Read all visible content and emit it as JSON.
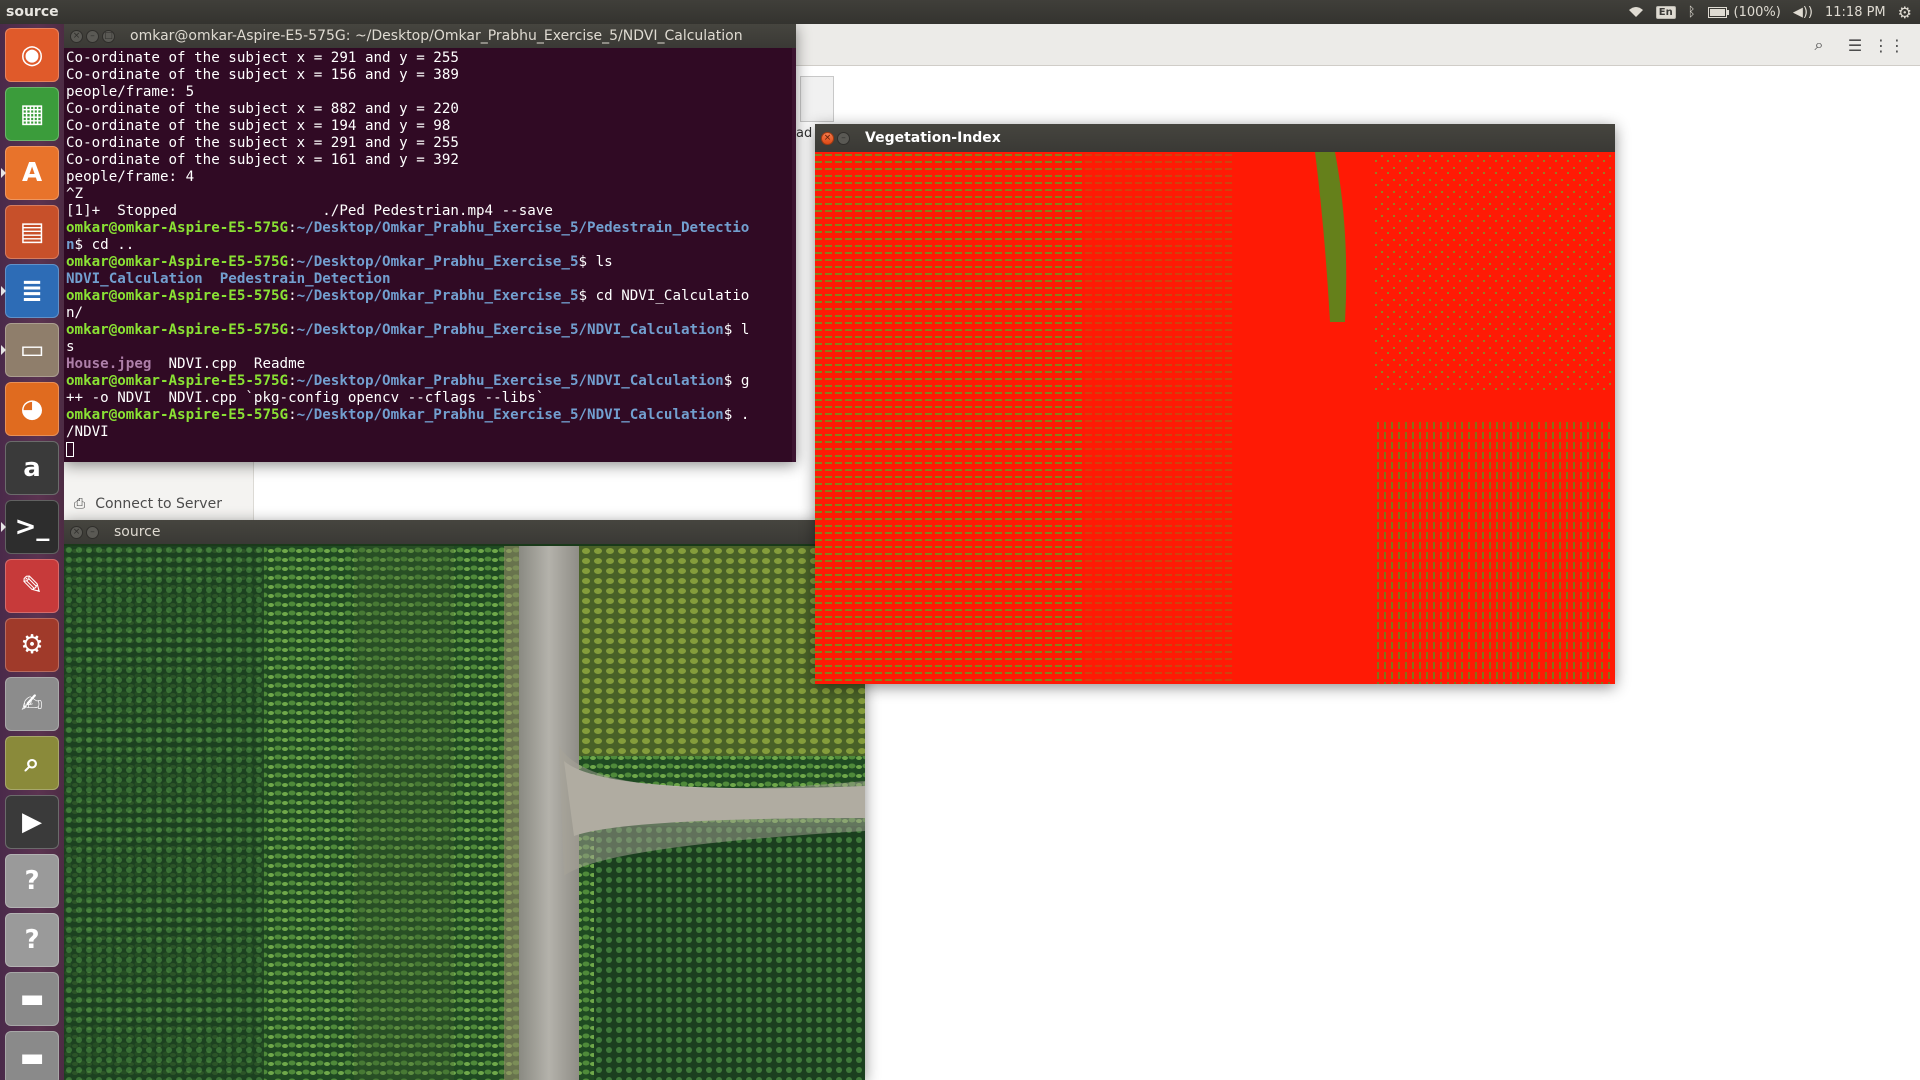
{
  "top_panel": {
    "app_title": "source",
    "keyboard": "En",
    "battery": "(100%)",
    "time": "11:18 PM"
  },
  "launcher": {
    "items": [
      {
        "name": "dash-home-icon",
        "glyph": "◉",
        "bg": "#e05a2a"
      },
      {
        "name": "libreoffice-calc-icon",
        "glyph": "▦",
        "bg": "#3b9c3b"
      },
      {
        "name": "software-center-icon",
        "glyph": "A",
        "bg": "#e8732b"
      },
      {
        "name": "libreoffice-impress-icon",
        "glyph": "▤",
        "bg": "#c7502a"
      },
      {
        "name": "libreoffice-writer-icon",
        "glyph": "≣",
        "bg": "#2d6cb6"
      },
      {
        "name": "files-icon",
        "glyph": "▭",
        "bg": "#8f7e6b"
      },
      {
        "name": "firefox-icon",
        "glyph": "◕",
        "bg": "#e06b1f"
      },
      {
        "name": "amazon-icon",
        "glyph": "a",
        "bg": "#3a3a3a"
      },
      {
        "name": "terminal-icon",
        "glyph": ">_",
        "bg": "#2d2d2d"
      },
      {
        "name": "evince-icon",
        "glyph": "✎",
        "bg": "#c73a3a"
      },
      {
        "name": "system-settings-icon",
        "glyph": "⚙",
        "bg": "#a03a2a"
      },
      {
        "name": "text-editor-icon",
        "glyph": "✍",
        "bg": "#8c8c8c"
      },
      {
        "name": "image-viewer-icon",
        "glyph": "⌕",
        "bg": "#8a8a3a"
      },
      {
        "name": "video-editor-icon",
        "glyph": "▶",
        "bg": "#3a3a3a"
      },
      {
        "name": "unknown-app-icon",
        "glyph": "?",
        "bg": "#9a9a9a"
      },
      {
        "name": "unknown-app-2-icon",
        "glyph": "?",
        "bg": "#9a9a9a"
      },
      {
        "name": "drive-icon",
        "glyph": "▬",
        "bg": "#8a8a8a"
      },
      {
        "name": "drive-2-icon",
        "glyph": "▬",
        "bg": "#8a8a8a"
      }
    ]
  },
  "files": {
    "connect_server": "Connect to Server",
    "partial_file_label": "ad"
  },
  "terminal": {
    "title": "omkar@omkar-Aspire-E5-575G: ~/Desktop/Omkar_Prabhu_Exercise_5/NDVI_Calculation",
    "lines": [
      {
        "segs": [
          {
            "t": "Co-ordinate of the subject x = 291 and y = 255",
            "c": ""
          }
        ]
      },
      {
        "segs": [
          {
            "t": "Co-ordinate of the subject x = 156 and y = 389",
            "c": ""
          }
        ]
      },
      {
        "segs": [
          {
            "t": "people/frame: 5",
            "c": ""
          }
        ]
      },
      {
        "segs": [
          {
            "t": "Co-ordinate of the subject x = 882 and y = 220",
            "c": ""
          }
        ]
      },
      {
        "segs": [
          {
            "t": "Co-ordinate of the subject x = 194 and y = 98",
            "c": ""
          }
        ]
      },
      {
        "segs": [
          {
            "t": "Co-ordinate of the subject x = 291 and y = 255",
            "c": ""
          }
        ]
      },
      {
        "segs": [
          {
            "t": "Co-ordinate of the subject x = 161 and y = 392",
            "c": ""
          }
        ]
      },
      {
        "segs": [
          {
            "t": "people/frame: 4",
            "c": ""
          }
        ]
      },
      {
        "segs": [
          {
            "t": "^Z",
            "c": ""
          }
        ]
      },
      {
        "segs": [
          {
            "t": "[1]+  Stopped                 ./Ped Pedestrian.mp4 --save",
            "c": ""
          }
        ]
      },
      {
        "segs": [
          {
            "t": "omkar@omkar-Aspire-E5-575G",
            "c": "t-user"
          },
          {
            "t": ":",
            "c": ""
          },
          {
            "t": "~/Desktop/Omkar_Prabhu_Exercise_5/Pedestrain_Detectio",
            "c": "t-path"
          }
        ]
      },
      {
        "segs": [
          {
            "t": "n",
            "c": "t-path"
          },
          {
            "t": "$ cd ..",
            "c": ""
          }
        ]
      },
      {
        "segs": [
          {
            "t": "omkar@omkar-Aspire-E5-575G",
            "c": "t-user"
          },
          {
            "t": ":",
            "c": ""
          },
          {
            "t": "~/Desktop/Omkar_Prabhu_Exercise_5",
            "c": "t-path"
          },
          {
            "t": "$ ls",
            "c": ""
          }
        ]
      },
      {
        "segs": [
          {
            "t": "NDVI_Calculation",
            "c": "t-dir"
          },
          {
            "t": "  ",
            "c": ""
          },
          {
            "t": "Pedestrain_Detection",
            "c": "t-dir"
          }
        ]
      },
      {
        "segs": [
          {
            "t": "omkar@omkar-Aspire-E5-575G",
            "c": "t-user"
          },
          {
            "t": ":",
            "c": ""
          },
          {
            "t": "~/Desktop/Omkar_Prabhu_Exercise_5",
            "c": "t-path"
          },
          {
            "t": "$ cd NDVI_Calculatio",
            "c": ""
          }
        ]
      },
      {
        "segs": [
          {
            "t": "n/",
            "c": ""
          }
        ]
      },
      {
        "segs": [
          {
            "t": "omkar@omkar-Aspire-E5-575G",
            "c": "t-user"
          },
          {
            "t": ":",
            "c": ""
          },
          {
            "t": "~/Desktop/Omkar_Prabhu_Exercise_5/NDVI_Calculation",
            "c": "t-path"
          },
          {
            "t": "$ l",
            "c": ""
          }
        ]
      },
      {
        "segs": [
          {
            "t": "s",
            "c": ""
          }
        ]
      },
      {
        "segs": [
          {
            "t": "House.jpeg",
            "c": "t-img"
          },
          {
            "t": "  NDVI.cpp  Readme",
            "c": ""
          }
        ]
      },
      {
        "segs": [
          {
            "t": "omkar@omkar-Aspire-E5-575G",
            "c": "t-user"
          },
          {
            "t": ":",
            "c": ""
          },
          {
            "t": "~/Desktop/Omkar_Prabhu_Exercise_5/NDVI_Calculation",
            "c": "t-path"
          },
          {
            "t": "$ g",
            "c": ""
          }
        ]
      },
      {
        "segs": [
          {
            "t": "++ -o NDVI  NDVI.cpp `pkg-config opencv --cflags --libs`",
            "c": ""
          }
        ]
      },
      {
        "segs": [
          {
            "t": "omkar@omkar-Aspire-E5-575G",
            "c": "t-user"
          },
          {
            "t": ":",
            "c": ""
          },
          {
            "t": "~/Desktop/Omkar_Prabhu_Exercise_5/NDVI_Calculation",
            "c": "t-path"
          },
          {
            "t": "$ .",
            "c": ""
          }
        ]
      },
      {
        "segs": [
          {
            "t": "/NDVI",
            "c": ""
          }
        ]
      }
    ]
  },
  "veg_window": {
    "title": "Vegetation-Index"
  },
  "source_window": {
    "title": "source"
  }
}
